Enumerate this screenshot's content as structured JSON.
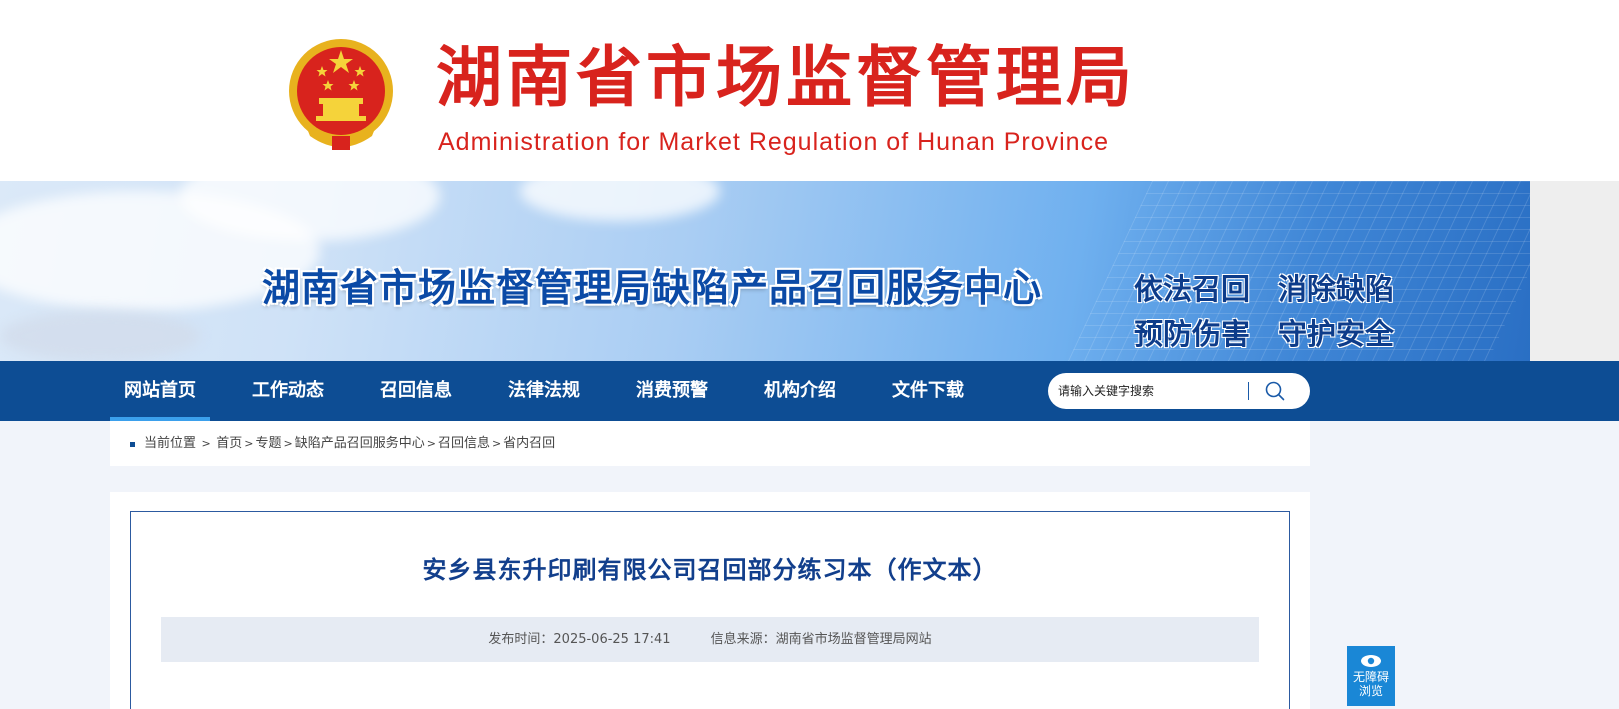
{
  "header": {
    "title_cn": "湖南省市场监督管理局",
    "title_en": "Administration for Market Regulation of Hunan Province",
    "emblem_icon": "national-emblem-icon",
    "brand_color": "#d8231d"
  },
  "banner": {
    "title": "湖南省市场监督管理局缺陷产品召回服务中心",
    "slogans": [
      "依法召回",
      "消除缺陷",
      "预防伤害",
      "守护安全"
    ]
  },
  "nav": {
    "items": [
      {
        "label": "网站首页",
        "active": true
      },
      {
        "label": "工作动态",
        "active": false
      },
      {
        "label": "召回信息",
        "active": false
      },
      {
        "label": "法律法规",
        "active": false
      },
      {
        "label": "消费预警",
        "active": false
      },
      {
        "label": "机构介绍",
        "active": false
      },
      {
        "label": "文件下载",
        "active": false
      }
    ],
    "background": "#0d4d94"
  },
  "search": {
    "placeholder": "请输入关键字搜索",
    "icon": "search-icon"
  },
  "breadcrumb": {
    "prefix": "当前位置",
    "items": [
      "首页",
      "专题",
      "缺陷产品召回服务中心",
      "召回信息",
      "省内召回"
    ]
  },
  "article": {
    "title": "安乡县东升印刷有限公司召回部分练习本（作文本）",
    "publish_time": "发布时间：2025-06-25 17:41",
    "source": "信息来源：湖南省市场监督管理局网站"
  },
  "accessibility": {
    "label_line1": "无障碍",
    "label_line2": "浏览",
    "icon": "eye-icon"
  }
}
